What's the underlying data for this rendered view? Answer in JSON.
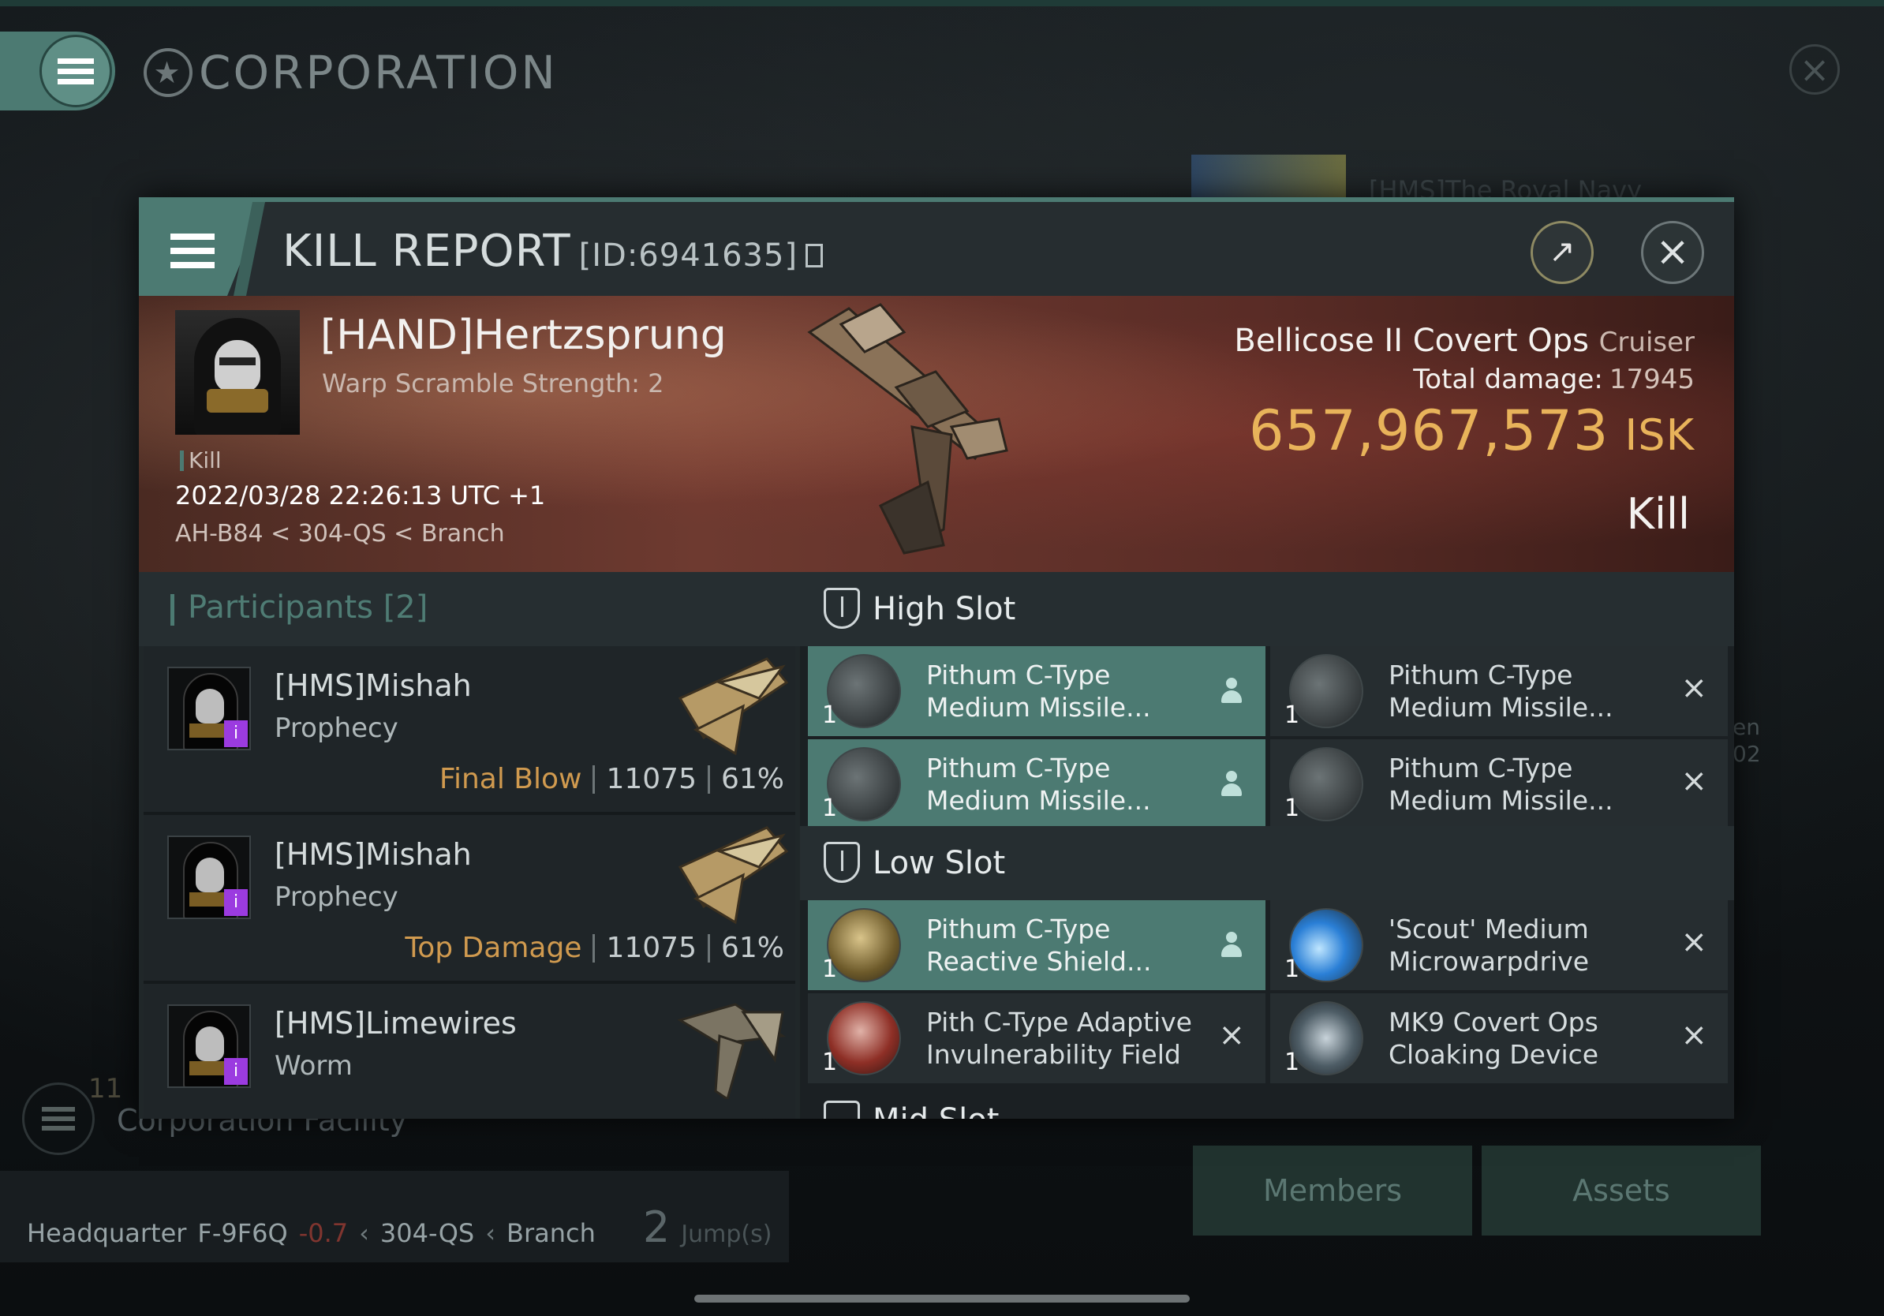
{
  "background": {
    "title": "CORPORATION",
    "right_panel_name": "[HMS]The Royal Navy",
    "right_side_text": [
      "en",
      "02"
    ],
    "facility_count": "11",
    "facility_label": "Corporation Facility",
    "hq": {
      "label": "Headquarter",
      "system": "F-9F6Q",
      "security": "-0.7",
      "route": [
        "304-QS",
        "Branch"
      ],
      "jumps": "2",
      "jumps_label": "Jump(s)"
    },
    "buttons": {
      "members": "Members",
      "assets": "Assets"
    }
  },
  "modal": {
    "title": "KILL REPORT",
    "id": "[ID:6941635]",
    "victim": {
      "name": "[HAND]Hertzsprung",
      "warp_scramble": "Warp Scramble Strength: 2",
      "tag": "Kill",
      "datetime": "2022/03/28 22:26:13 UTC +1",
      "location": "AH-B84 < 304-QS < Branch"
    },
    "ship": {
      "name": "Bellicose II Covert Ops",
      "class": "Cruiser",
      "total_damage_label": "Total damage:",
      "total_damage": "17945",
      "isk_value": "657,967,573",
      "isk_unit": "ISK",
      "result": "Kill"
    },
    "participants": {
      "label": "Participants",
      "count": "[2]",
      "rows": [
        {
          "name": "[HMS]Mishah",
          "ship": "Prophecy",
          "role": "Final Blow",
          "damage": "11075",
          "percent": "61%"
        },
        {
          "name": "[HMS]Mishah",
          "ship": "Prophecy",
          "role": "Top Damage",
          "damage": "11075",
          "percent": "61%"
        },
        {
          "name": "[HMS]Limewires",
          "ship": "Worm",
          "role": "",
          "damage": "",
          "percent": ""
        }
      ]
    },
    "slots": {
      "high": {
        "label": "High Slot",
        "items": [
          {
            "qty": "1",
            "name": "Pithum C-Type\nMedium Missile...",
            "state": "dropped"
          },
          {
            "qty": "1",
            "name": "Pithum C-Type\nMedium Missile...",
            "state": "destroyed"
          },
          {
            "qty": "1",
            "name": "Pithum C-Type\nMedium Missile...",
            "state": "dropped"
          },
          {
            "qty": "1",
            "name": "Pithum C-Type\nMedium Missile...",
            "state": "destroyed"
          }
        ]
      },
      "low": {
        "label": "Low Slot",
        "items": [
          {
            "qty": "1",
            "name": "Pithum C-Type\nReactive Shield...",
            "state": "dropped"
          },
          {
            "qty": "1",
            "name": "'Scout' Medium\nMicrowarpdrive",
            "state": "destroyed"
          },
          {
            "qty": "1",
            "name": "Pith C-Type Adaptive\nInvulnerability Field",
            "state": "destroyed"
          },
          {
            "qty": "1",
            "name": "MK9 Covert Ops\nCloaking Device",
            "state": "destroyed"
          }
        ]
      },
      "mid": {
        "label": "Mid Slot"
      }
    }
  },
  "colors": {
    "accent_teal": "#4c7a72",
    "isk_gold": "#e8b35a",
    "role_orange": "#d09a4f",
    "sec_red": "#c6453a"
  }
}
